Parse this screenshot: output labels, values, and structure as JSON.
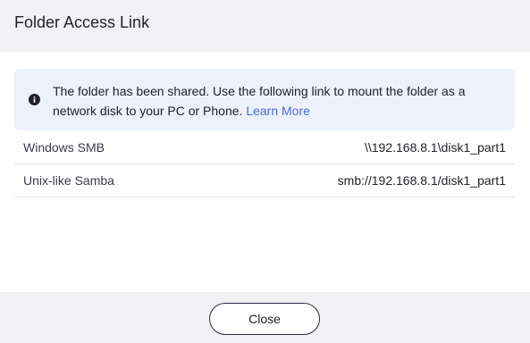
{
  "dialog": {
    "title": "Folder Access Link"
  },
  "info": {
    "icon": "info-icon",
    "message": "The folder has been shared. Use the following link to mount the folder as a network disk to your PC or Phone.",
    "link_label": "Learn More",
    "colors": {
      "background": "#edf1fb",
      "link": "#4a6cd8"
    }
  },
  "links": [
    {
      "label": "Windows SMB",
      "value": "\\\\192.168.8.1\\disk1_part1"
    },
    {
      "label": "Unix-like Samba",
      "value": "smb://192.168.8.1/disk1_part1"
    }
  ],
  "footer": {
    "close_label": "Close"
  }
}
